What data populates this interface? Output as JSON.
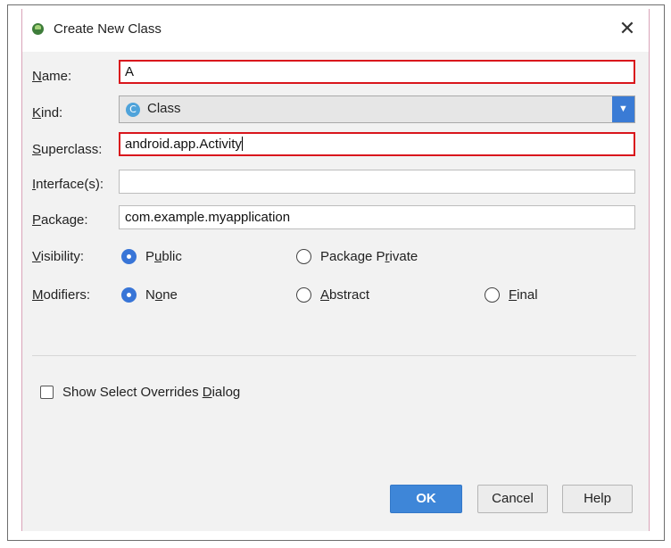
{
  "dialog": {
    "title": "Create New Class",
    "close_glyph": "✕"
  },
  "form": {
    "name": {
      "label_pre": "",
      "label_key": "N",
      "label_post": "ame:",
      "value": "A"
    },
    "kind": {
      "label_pre": "",
      "label_key": "K",
      "label_post": "ind:",
      "icon_letter": "C",
      "value": "Class",
      "arrow_glyph": "▼"
    },
    "superclass": {
      "label_pre": "",
      "label_key": "S",
      "label_post": "uperclass:",
      "value": "android.app.Activity"
    },
    "interfaces": {
      "label_pre": "",
      "label_key": "I",
      "label_post": "nterface(s):",
      "value": ""
    },
    "package": {
      "label_pre": "",
      "label_key": "P",
      "label_post": "ackage:",
      "value": "com.example.myapplication"
    },
    "visibility": {
      "label_pre": "",
      "label_key": "V",
      "label_post": "isibility:",
      "options": [
        {
          "pre": "P",
          "key": "u",
          "post": "blic",
          "selected": true
        },
        {
          "pre": "Package P",
          "key": "r",
          "post": "ivate",
          "selected": false
        }
      ]
    },
    "modifiers": {
      "label_pre": "",
      "label_key": "M",
      "label_post": "odifiers:",
      "options": [
        {
          "pre": "N",
          "key": "o",
          "post": "ne",
          "selected": true
        },
        {
          "pre": "",
          "key": "A",
          "post": "bstract",
          "selected": false
        },
        {
          "pre": "",
          "key": "F",
          "post": "inal",
          "selected": false
        }
      ]
    }
  },
  "overrides": {
    "pre": "Show Select Overrides ",
    "key": "D",
    "post": "ialog",
    "checked": false
  },
  "buttons": {
    "ok": "OK",
    "cancel": "Cancel",
    "help": "Help"
  },
  "colors": {
    "accent": "#3875d7",
    "error_border": "#d9161c",
    "primary_button": "#3e86d8"
  }
}
